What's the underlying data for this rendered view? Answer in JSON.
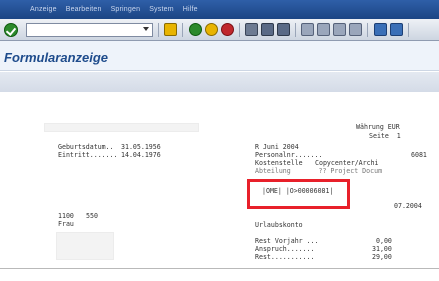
{
  "menu": [
    "Anzeige",
    "Bearbeiten",
    "Springen",
    "System",
    "Hilfe"
  ],
  "toolbar": {
    "command_value": "",
    "icons": [
      "enter-icon",
      "save-icon",
      "back-icon",
      "exit-icon",
      "cancel-icon",
      "print-icon",
      "find-icon",
      "find-next-icon",
      "first-page-icon",
      "prev-page-icon",
      "next-page-icon",
      "last-page-icon",
      "new-session-icon",
      "shortcut-icon"
    ],
    "colors": {
      "green": "#2c8a2c",
      "yellow": "#e8b400",
      "red": "#c0272d",
      "blue": "#3a6fb7"
    }
  },
  "page_title": "Formularanzeige",
  "report": {
    "left": {
      "birth_label": "Geburtsdatum..",
      "birth_value": "31.05.1956",
      "entry_label": "Eintritt.......",
      "entry_value": "14.04.1976",
      "code1": "1100",
      "code2": "550",
      "salutation": "Frau"
    },
    "right": {
      "currency": "Währung EUR",
      "page": "Seite  1",
      "period": "R Juni 2004",
      "personnel_label": "Personalnr.......",
      "personnel_value": "6081",
      "costcenter_label": "Kostenstelle",
      "costcenter_value": "Copycenter/Archi",
      "hidden_line_partial": "Abteilung       ?? Project Docum",
      "highlight_text": "|OME| |O>00006081|",
      "date_tail": "07.2004",
      "vacation_header": "Urlaubskonto",
      "rest_prev_label": "Rest Vorjahr ...",
      "rest_prev_value": "0,00",
      "entitlement_label": "Anspruch.......",
      "entitlement_value": "31,00",
      "rest_label": "Rest...........",
      "rest_value": "29,00"
    },
    "highlight_color": "#e8202a"
  }
}
